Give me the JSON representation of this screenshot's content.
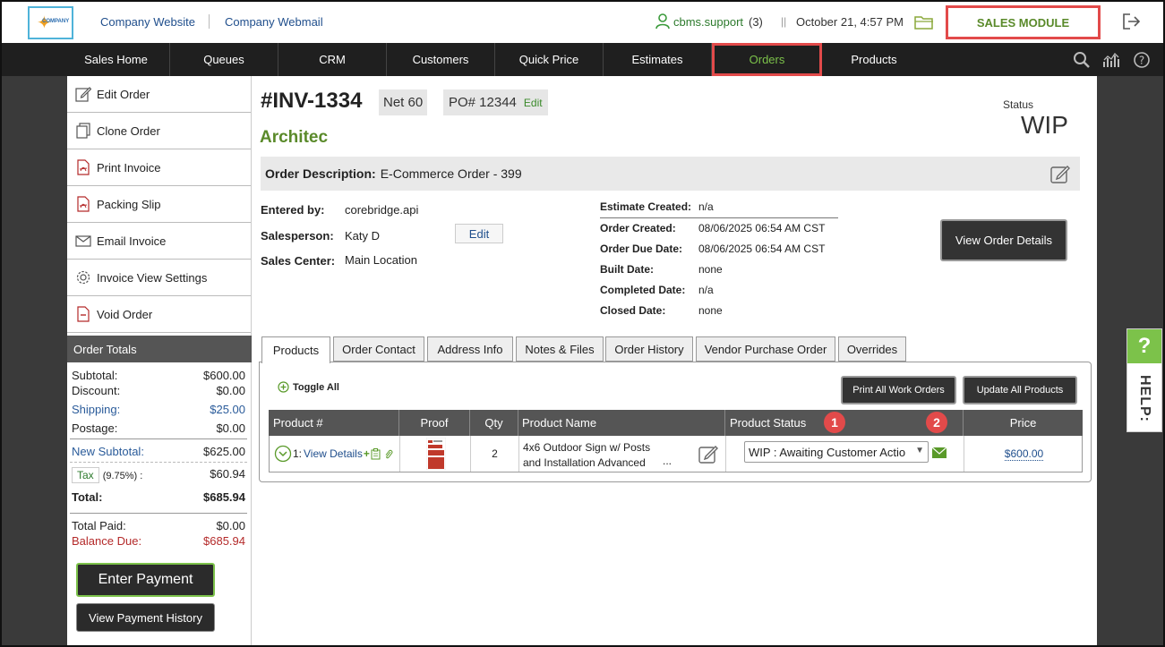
{
  "topbar": {
    "logo_text": "COMPANY",
    "company_website": "Company Website",
    "company_webmail": "Company Webmail",
    "user": "cbms.support",
    "user_count": "(3)",
    "separator": "||",
    "datetime": "October 21, 4:57 PM",
    "sales_module": "SALES MODULE"
  },
  "nav": {
    "items": [
      {
        "label": "Sales Home"
      },
      {
        "label": "Queues"
      },
      {
        "label": "CRM"
      },
      {
        "label": "Customers"
      },
      {
        "label": "Quick Price"
      },
      {
        "label": "Estimates"
      },
      {
        "label": "Orders"
      },
      {
        "label": "Products"
      }
    ],
    "active": "Orders"
  },
  "sidebar": {
    "items": [
      {
        "label": "Edit Order",
        "icon": "edit-icon"
      },
      {
        "label": "Clone Order",
        "icon": "clone-icon"
      },
      {
        "label": "Print Invoice",
        "icon": "pdf-icon"
      },
      {
        "label": "Packing Slip",
        "icon": "pdf-icon"
      },
      {
        "label": "Email Invoice",
        "icon": "envelope-icon"
      },
      {
        "label": "Invoice View Settings",
        "icon": "gear-icon"
      },
      {
        "label": "Void Order",
        "icon": "void-icon"
      }
    ]
  },
  "totals": {
    "header": "Order Totals",
    "subtotal_label": "Subtotal:",
    "subtotal": "$600.00",
    "discount_label": "Discount:",
    "discount": "$0.00",
    "shipping_label": "Shipping:",
    "shipping": "$25.00",
    "postage_label": "Postage:",
    "postage": "$0.00",
    "new_subtotal_label": "New Subtotal:",
    "new_subtotal": "$625.00",
    "tax_label": "Tax",
    "tax_pct": "(9.75%) :",
    "tax": "$60.94",
    "total_label": "Total:",
    "total": "$685.94",
    "total_paid_label": "Total Paid:",
    "total_paid": "$0.00",
    "balance_due_label": "Balance Due:",
    "balance_due": "$685.94"
  },
  "buttons": {
    "enter_payment": "Enter Payment",
    "view_payment_history": "View Payment History"
  },
  "order": {
    "number": "#INV-1334",
    "terms": "Net 60",
    "po": "PO# 12344",
    "po_edit": "Edit",
    "customer": "Architec",
    "status_label": "Status",
    "status": "WIP",
    "description_label": "Order Description:",
    "description": "E-Commerce Order - 399",
    "entered_by_label": "Entered by:",
    "entered_by": "corebridge.api",
    "salesperson_label": "Salesperson:",
    "salesperson": "Katy D",
    "salesperson_edit": "Edit",
    "sales_center_label": "Sales Center:",
    "sales_center": "Main Location",
    "estimate_created_label": "Estimate Created:",
    "estimate_created": "n/a",
    "order_created_label": "Order Created:",
    "order_created": "08/06/2025 06:54 AM CST",
    "order_due_label": "Order Due Date:",
    "order_due": "08/06/2025 06:54 AM CST",
    "built_label": "Built Date:",
    "built": "none",
    "completed_label": "Completed Date:",
    "completed": "n/a",
    "closed_label": "Closed Date:",
    "closed": "none",
    "view_details_button": "View Order Details"
  },
  "tabs": [
    {
      "label": "Products"
    },
    {
      "label": "Order Contact"
    },
    {
      "label": "Address Info"
    },
    {
      "label": "Notes & Files"
    },
    {
      "label": "Order History"
    },
    {
      "label": "Vendor Purchase Order"
    },
    {
      "label": "Overrides"
    }
  ],
  "products": {
    "toggle_all": "Toggle All",
    "print_all": "Print All Work Orders",
    "update_all": "Update All Products",
    "columns": [
      "Product #",
      "Proof",
      "Qty",
      "Product Name",
      "Product Status",
      "Price"
    ],
    "rows": [
      {
        "num": "1:",
        "view_details": "View Details",
        "qty": "2",
        "name_line1": "4x6 Outdoor Sign w/ Posts",
        "name_line2": "and Installation Advanced",
        "ellipsis": "...",
        "status": "WIP : Awaiting Customer Actio",
        "price": "$600.00"
      }
    ],
    "callouts": [
      "1",
      "2"
    ]
  },
  "help": {
    "q": "?",
    "label": "HELP:"
  },
  "colors": {
    "accent_green": "#7cc24a",
    "highlight_red": "#e24a4a",
    "link_blue": "#2a5b9a",
    "nav_bg": "#1f1f1f"
  }
}
